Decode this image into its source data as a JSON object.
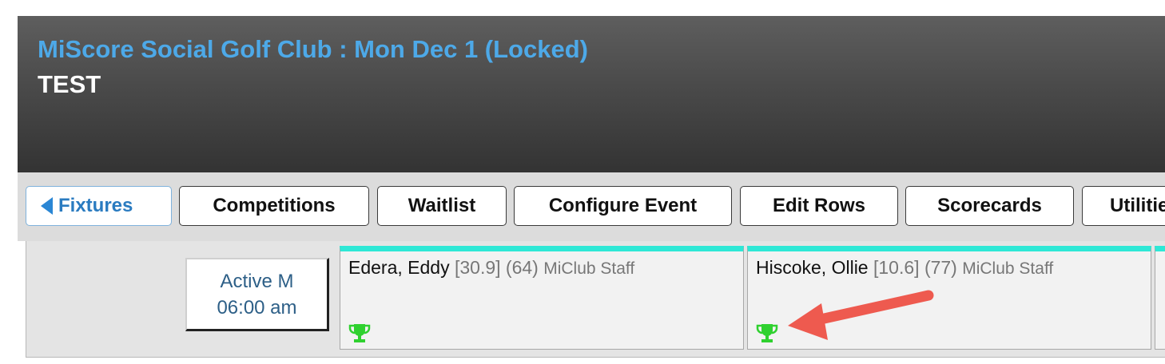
{
  "header": {
    "title": "MiScore Social Golf Club : Mon Dec 1 (Locked)",
    "subtitle": "TEST"
  },
  "toolbar": {
    "back_label": "Fixtures",
    "buttons": [
      "Competitions",
      "Waitlist",
      "Configure Event",
      "Edit Rows",
      "Scorecards",
      "Utilitie"
    ]
  },
  "timeslot": {
    "status": "Active M",
    "time": "06:00 am"
  },
  "players": [
    {
      "name": "Edera, Eddy",
      "handicap": "[30.9]",
      "number": "(64)",
      "group": "MiClub Staff",
      "icon": "trophy-icon"
    },
    {
      "name": "Hiscoke, Ollie",
      "handicap": "[10.6]",
      "number": "(77)",
      "group": "MiClub Staff",
      "icon": "trophy-icon"
    }
  ],
  "colors": {
    "title": "#4da9e8",
    "slot_accent": "#2ee8d6",
    "trophy": "#2fd12f",
    "annotation_arrow": "#ee5a4f"
  }
}
